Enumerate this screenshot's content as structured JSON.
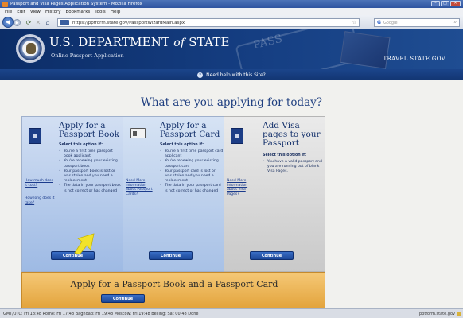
{
  "window": {
    "title": "Passport and Visa Pages Application System - Mozilla Firefox",
    "controls": [
      "–",
      "□",
      "✕"
    ]
  },
  "menu": [
    "File",
    "Edit",
    "View",
    "History",
    "Bookmarks",
    "Tools",
    "Help"
  ],
  "toolbar": {
    "url": "https://pptform.state.gov/PassportWizardMain.aspx",
    "search_placeholder": "Google"
  },
  "header": {
    "agency_main": "U.S. DEPARTMENT",
    "agency_of": "of",
    "agency_state": "STATE",
    "app_name": "Online Passport Application",
    "watermark": "PASS",
    "travel_link": "TRAVEL.STATE.GOV"
  },
  "help": {
    "label": "Need help with this Site?"
  },
  "main": {
    "question": "What are you applying for today?",
    "options": [
      {
        "title": "Apply for a Passport Book",
        "select_note": "Select this option if:",
        "bullets": [
          "You're a first time passport book applicant",
          "You're renewing your existing passport book",
          "Your passport book is lost or was stolen and you need a replacement",
          "The data in your passport book is not correct or has changed"
        ],
        "side_links": [
          "How much does it cost?",
          "How long does it take?"
        ],
        "button": "Continue"
      },
      {
        "title": "Apply for a Passport Card",
        "select_note": "Select this option if:",
        "bullets": [
          "You're a first time passport card applicant",
          "You're renewing your existing passport card",
          "Your passport card is lost or was stolen and you need a replacement",
          "The data in your passport card is not correct or has changed"
        ],
        "side_links": [
          "Need More Information about Passport Cards?"
        ],
        "button": "Continue"
      },
      {
        "title": "Add Visa pages to your Passport",
        "select_note": "Select this option if:",
        "bullets": [
          "You have a valid passport and you are running out of blank Visa Pages."
        ],
        "side_links": [
          "Need More Information about Visa Pages?"
        ],
        "button": "Continue"
      }
    ],
    "combo": {
      "title": "Apply for a Passport Book and a Passport Card",
      "button": "Continue"
    }
  },
  "status": {
    "clocks": "GMT/UTC: Fri 18:48    Rome: Fri 17:48    Baghdad: Fri 19:48    Moscow: Fri 19:48    Beijing: Sat 00:48    Done",
    "host": "pptform.state.gov"
  },
  "colors": {
    "header_bg": "#153e82",
    "book_panel": "#9ebae4",
    "card_panel": "#a8c1e6",
    "visa_panel": "#c9c9c9",
    "combo_panel": "#e3a43d",
    "button": "#1c4797",
    "arrow": "#f2e32a"
  }
}
